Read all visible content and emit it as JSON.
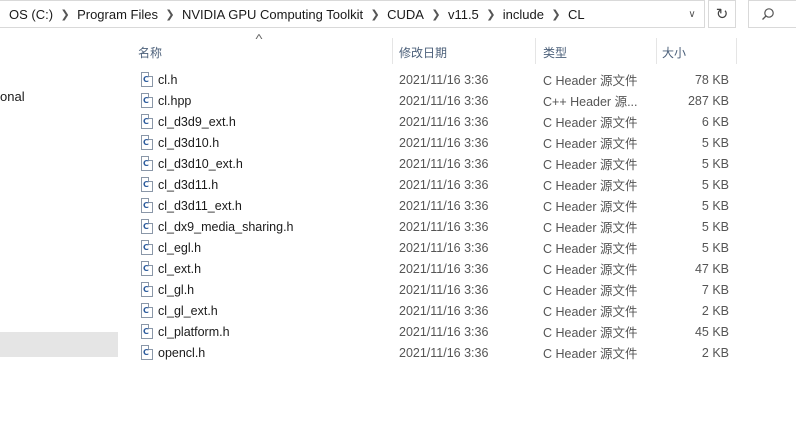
{
  "address": {
    "crumbs": [
      "OS (C:)",
      "Program Files",
      "NVIDIA GPU Computing Toolkit",
      "CUDA",
      "v11.5",
      "include",
      "CL"
    ],
    "refresh_icon": "↻",
    "search_icon": "⌕"
  },
  "nav": {
    "partial_item": "onal"
  },
  "columns": {
    "name": "名称",
    "date": "修改日期",
    "type": "类型",
    "size": "大小"
  },
  "files": [
    {
      "name": "cl.h",
      "date": "2021/11/16 3:36",
      "type": "C Header 源文件",
      "size": "78 KB"
    },
    {
      "name": "cl.hpp",
      "date": "2021/11/16 3:36",
      "type": "C++ Header 源...",
      "size": "287 KB"
    },
    {
      "name": "cl_d3d9_ext.h",
      "date": "2021/11/16 3:36",
      "type": "C Header 源文件",
      "size": "6 KB"
    },
    {
      "name": "cl_d3d10.h",
      "date": "2021/11/16 3:36",
      "type": "C Header 源文件",
      "size": "5 KB"
    },
    {
      "name": "cl_d3d10_ext.h",
      "date": "2021/11/16 3:36",
      "type": "C Header 源文件",
      "size": "5 KB"
    },
    {
      "name": "cl_d3d11.h",
      "date": "2021/11/16 3:36",
      "type": "C Header 源文件",
      "size": "5 KB"
    },
    {
      "name": "cl_d3d11_ext.h",
      "date": "2021/11/16 3:36",
      "type": "C Header 源文件",
      "size": "5 KB"
    },
    {
      "name": "cl_dx9_media_sharing.h",
      "date": "2021/11/16 3:36",
      "type": "C Header 源文件",
      "size": "5 KB"
    },
    {
      "name": "cl_egl.h",
      "date": "2021/11/16 3:36",
      "type": "C Header 源文件",
      "size": "5 KB"
    },
    {
      "name": "cl_ext.h",
      "date": "2021/11/16 3:36",
      "type": "C Header 源文件",
      "size": "47 KB"
    },
    {
      "name": "cl_gl.h",
      "date": "2021/11/16 3:36",
      "type": "C Header 源文件",
      "size": "7 KB"
    },
    {
      "name": "cl_gl_ext.h",
      "date": "2021/11/16 3:36",
      "type": "C Header 源文件",
      "size": "2 KB"
    },
    {
      "name": "cl_platform.h",
      "date": "2021/11/16 3:36",
      "type": "C Header 源文件",
      "size": "45 KB"
    },
    {
      "name": "opencl.h",
      "date": "2021/11/16 3:36",
      "type": "C Header 源文件",
      "size": "2 KB"
    }
  ]
}
